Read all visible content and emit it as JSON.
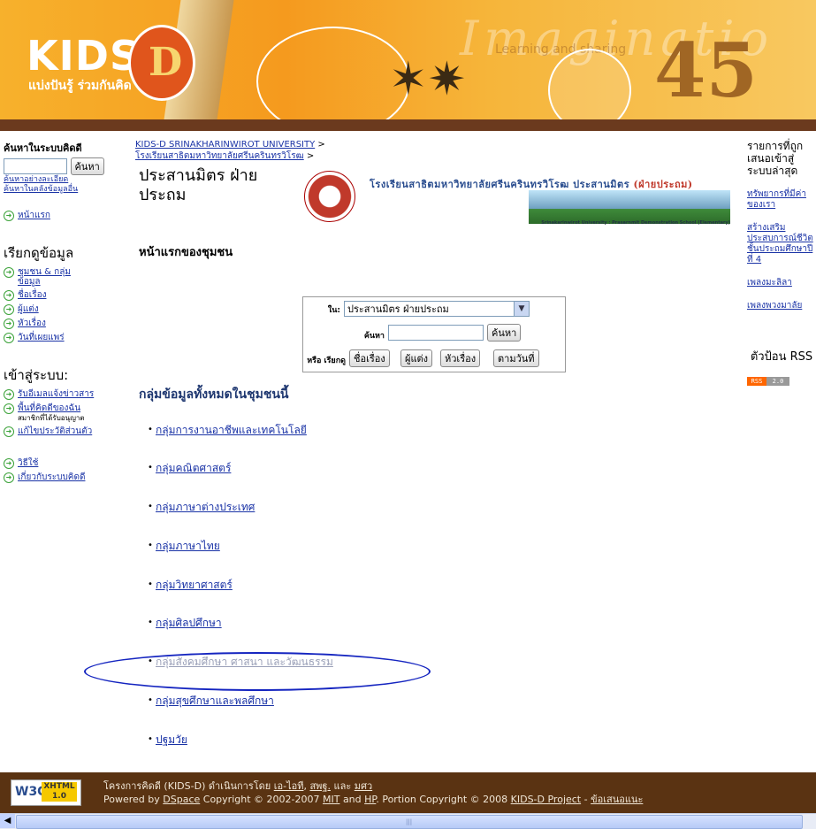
{
  "banner": {
    "logo": "KIDS",
    "logo_letter": "D",
    "tagline": "แบ่งปันรู้ ร่วมกันคิด",
    "watermark": "Imaginatio",
    "watermark2": "Learning and sharing",
    "number": "45"
  },
  "left": {
    "search_title": "ค้นหาในระบบคิดดี",
    "search_value": "",
    "search_button": "ค้นหา",
    "adv_link": "ค้นหาอย่างละเอียด",
    "other_link": "ค้นหาในคลังข้อมูลอื่น",
    "home": "หน้าแรก",
    "browse_title": "เรียกดูข้อมูล",
    "browse_items": [
      "ชุมชน & กลุ่มข้อมูล",
      "ชื่อเรื่อง",
      "ผู้แต่ง",
      "หัวเรื่อง",
      "วันที่เผยแพร่"
    ],
    "login_title": "เข้าสู่ระบบ:",
    "login_items": [
      "รับอีเมลแจ้งข่าวสาร",
      "พื้นที่คิดดีของฉัน",
      "แก้ไขประวัติส่วนตัว"
    ],
    "member_hint": "สมาชิกที่ได้รับอนุญาต",
    "help_items": [
      "วิธีใช้",
      "เกี่ยวกับระบบคิดดี"
    ]
  },
  "main": {
    "crumb1": "KIDS-D SRINAKHARINWIROT UNIVERSITY",
    "crumb2": "โรงเรียนสาธิตมหาวิทยาลัยศรีนครินทรวิโรฒ",
    "crumb_sep": ">",
    "community_title": "ประสานมิตร ฝ่ายประถม",
    "community_sub": "หน้าแรกของชุมชน",
    "school_name": "โรงเรียนสาธิตมหาวิทยาลัยศรีนครินทรวิโรฒ ประสานมิตร",
    "school_name_tail": "(ฝ่ายประถม)",
    "school_caption": "Srinakarinwirot University : Prasarnmit Demonstration School (Elementary)",
    "search": {
      "in_label": "ใน:",
      "in_value": "ประสานมิตร ฝ่ายประถม",
      "search_label": "ค้นหา",
      "search_button": "ค้นหา",
      "browse_label": "หรือ เรียกดู",
      "browse_buttons": [
        "ชื่อเรื่อง",
        "ผู้แต่ง",
        "หัวเรื่อง",
        "ตามวันที่"
      ]
    },
    "groups_title": "กลุ่มข้อมูลทั้งหมดในชุมชนนี้",
    "groups": [
      "กลุ่มการงานอาชีพและเทคโนโลยี",
      "กลุ่มคณิตศาสตร์",
      "กลุ่มภาษาต่างประเทศ",
      "กลุ่มภาษาไทย",
      "กลุ่มวิทยาศาสตร์",
      "กลุ่มศิลปศึกษา",
      "กลุ่มสังคมศึกษา ศาสนา และวัฒนธรรม",
      "กลุ่มสุขศึกษาและพลศึกษา",
      "ปฐมวัย"
    ]
  },
  "right": {
    "title": "รายการที่ถูกเสนอเข้าสู่ระบบล่าสุด",
    "links": [
      "ทรัพยากรที่มีค่าของเรา",
      "สร้างเสริมประสบการณ์ชีวิต ชั้นประถมศึกษาปีที่ 4",
      "เพลงมะลิลา",
      "เพลงพวงมาลัย"
    ],
    "rss_title": "ตัวป้อน RSS",
    "rss_left": "RSS",
    "rss_right": "2.0"
  },
  "footer": {
    "w3c": "W3C",
    "xhtml": "XHTML 1.0",
    "line1_prefix": "โครงการคิดดี (KIDS-D) ดำเนินการโดย",
    "line1_links": [
      "เอ-ไอที",
      "สพฐ."
    ],
    "line1_and": "และ",
    "line1_last": "มศว",
    "line2_a": "Powered by",
    "dspace": "DSpace",
    "line2_b": "Copyright © 2002-2007",
    "mit": "MIT",
    "and": "and",
    "hp": "HP",
    "line2_c": ". Portion Copyright © 2008",
    "kidsd": "KIDS-D Project",
    "dash": "-",
    "feedback": "ข้อเสนอแนะ"
  }
}
